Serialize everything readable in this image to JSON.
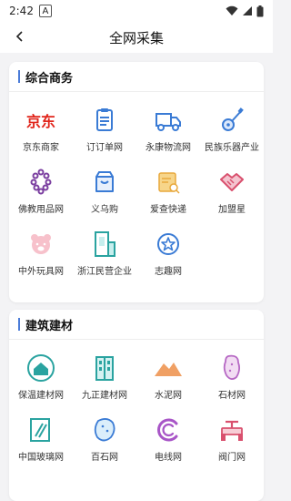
{
  "status_bar": {
    "time": "2:42",
    "notif_letter": "A"
  },
  "header": {
    "title": "全网采集"
  },
  "sections": [
    {
      "title": "综合商务",
      "items": [
        {
          "label": "京东商家",
          "icon": "jd-logo-icon",
          "logo_text": "京东"
        },
        {
          "label": "订订单网",
          "icon": "clipboard-icon"
        },
        {
          "label": "永康物流网",
          "icon": "truck-icon"
        },
        {
          "label": "民族乐器产业",
          "icon": "guitar-icon"
        },
        {
          "label": "佛教用品网",
          "icon": "prayer-beads-icon"
        },
        {
          "label": "义乌购",
          "icon": "shop-bag-icon"
        },
        {
          "label": "爱查快递",
          "icon": "package-search-icon"
        },
        {
          "label": "加盟星",
          "icon": "handshake-icon"
        },
        {
          "label": "中外玩具网",
          "icon": "toy-bear-icon"
        },
        {
          "label": "浙江民营企业",
          "icon": "building-icon"
        },
        {
          "label": "志趣网",
          "icon": "star-circle-icon"
        }
      ]
    },
    {
      "title": "建筑建材",
      "items": [
        {
          "label": "保温建材网",
          "icon": "house-icon"
        },
        {
          "label": "九正建材网",
          "icon": "cabinet-icon"
        },
        {
          "label": "水泥网",
          "icon": "mountain-icon"
        },
        {
          "label": "石材网",
          "icon": "stone-icon"
        },
        {
          "label": "中国玻璃网",
          "icon": "glass-icon"
        },
        {
          "label": "百石网",
          "icon": "rock-icon"
        },
        {
          "label": "电线网",
          "icon": "wire-icon"
        },
        {
          "label": "阀门网",
          "icon": "valve-icon"
        }
      ]
    }
  ],
  "colors": {
    "accent": "#4a7bd8",
    "jd_red": "#e1251b"
  }
}
